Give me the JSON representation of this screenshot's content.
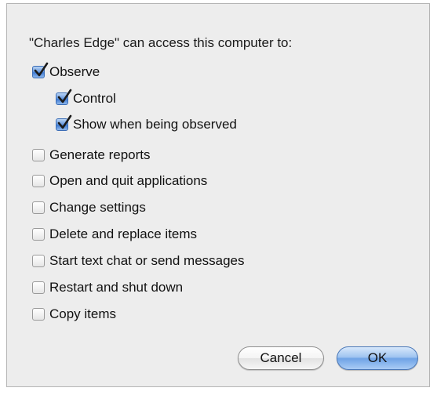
{
  "dialog": {
    "prompt": "\"Charles Edge\" can access this computer to:",
    "options": [
      {
        "label": "Observe",
        "checked": true
      },
      {
        "label": "Control",
        "checked": true
      },
      {
        "label": "Show when being observed",
        "checked": true
      },
      {
        "label": "Generate reports",
        "checked": false
      },
      {
        "label": "Open and quit applications",
        "checked": false
      },
      {
        "label": "Change settings",
        "checked": false
      },
      {
        "label": "Delete and replace items",
        "checked": false
      },
      {
        "label": "Start text chat or send messages",
        "checked": false
      },
      {
        "label": "Restart and shut down",
        "checked": false
      },
      {
        "label": "Copy items",
        "checked": false
      }
    ],
    "cancel_label": "Cancel",
    "ok_label": "OK"
  },
  "colors": {
    "dialog_background": "#ededed",
    "checkbox_accent": "#3f7bd2",
    "default_button": "#6fa3e6"
  }
}
